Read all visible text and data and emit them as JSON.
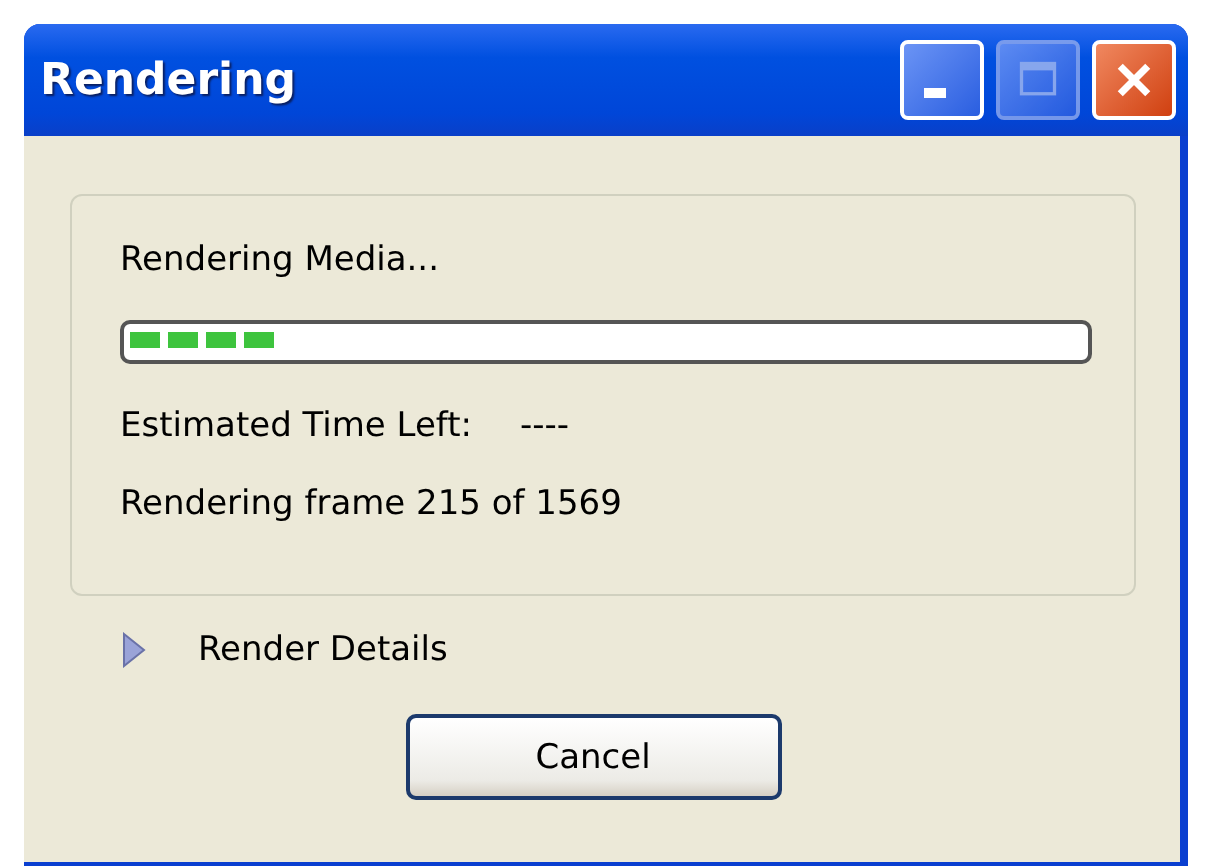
{
  "window": {
    "title": "Rendering"
  },
  "status": {
    "heading": "Rendering Media...",
    "level": 0.16,
    "time_left_label": "Estimated Time Left:",
    "time_left_value": "----",
    "frame_text": "Rendering frame 215 of 1569"
  },
  "details": {
    "label": "Render Details",
    "expanded": false
  },
  "buttons": [
    {
      "label": "Cancel"
    }
  ]
}
